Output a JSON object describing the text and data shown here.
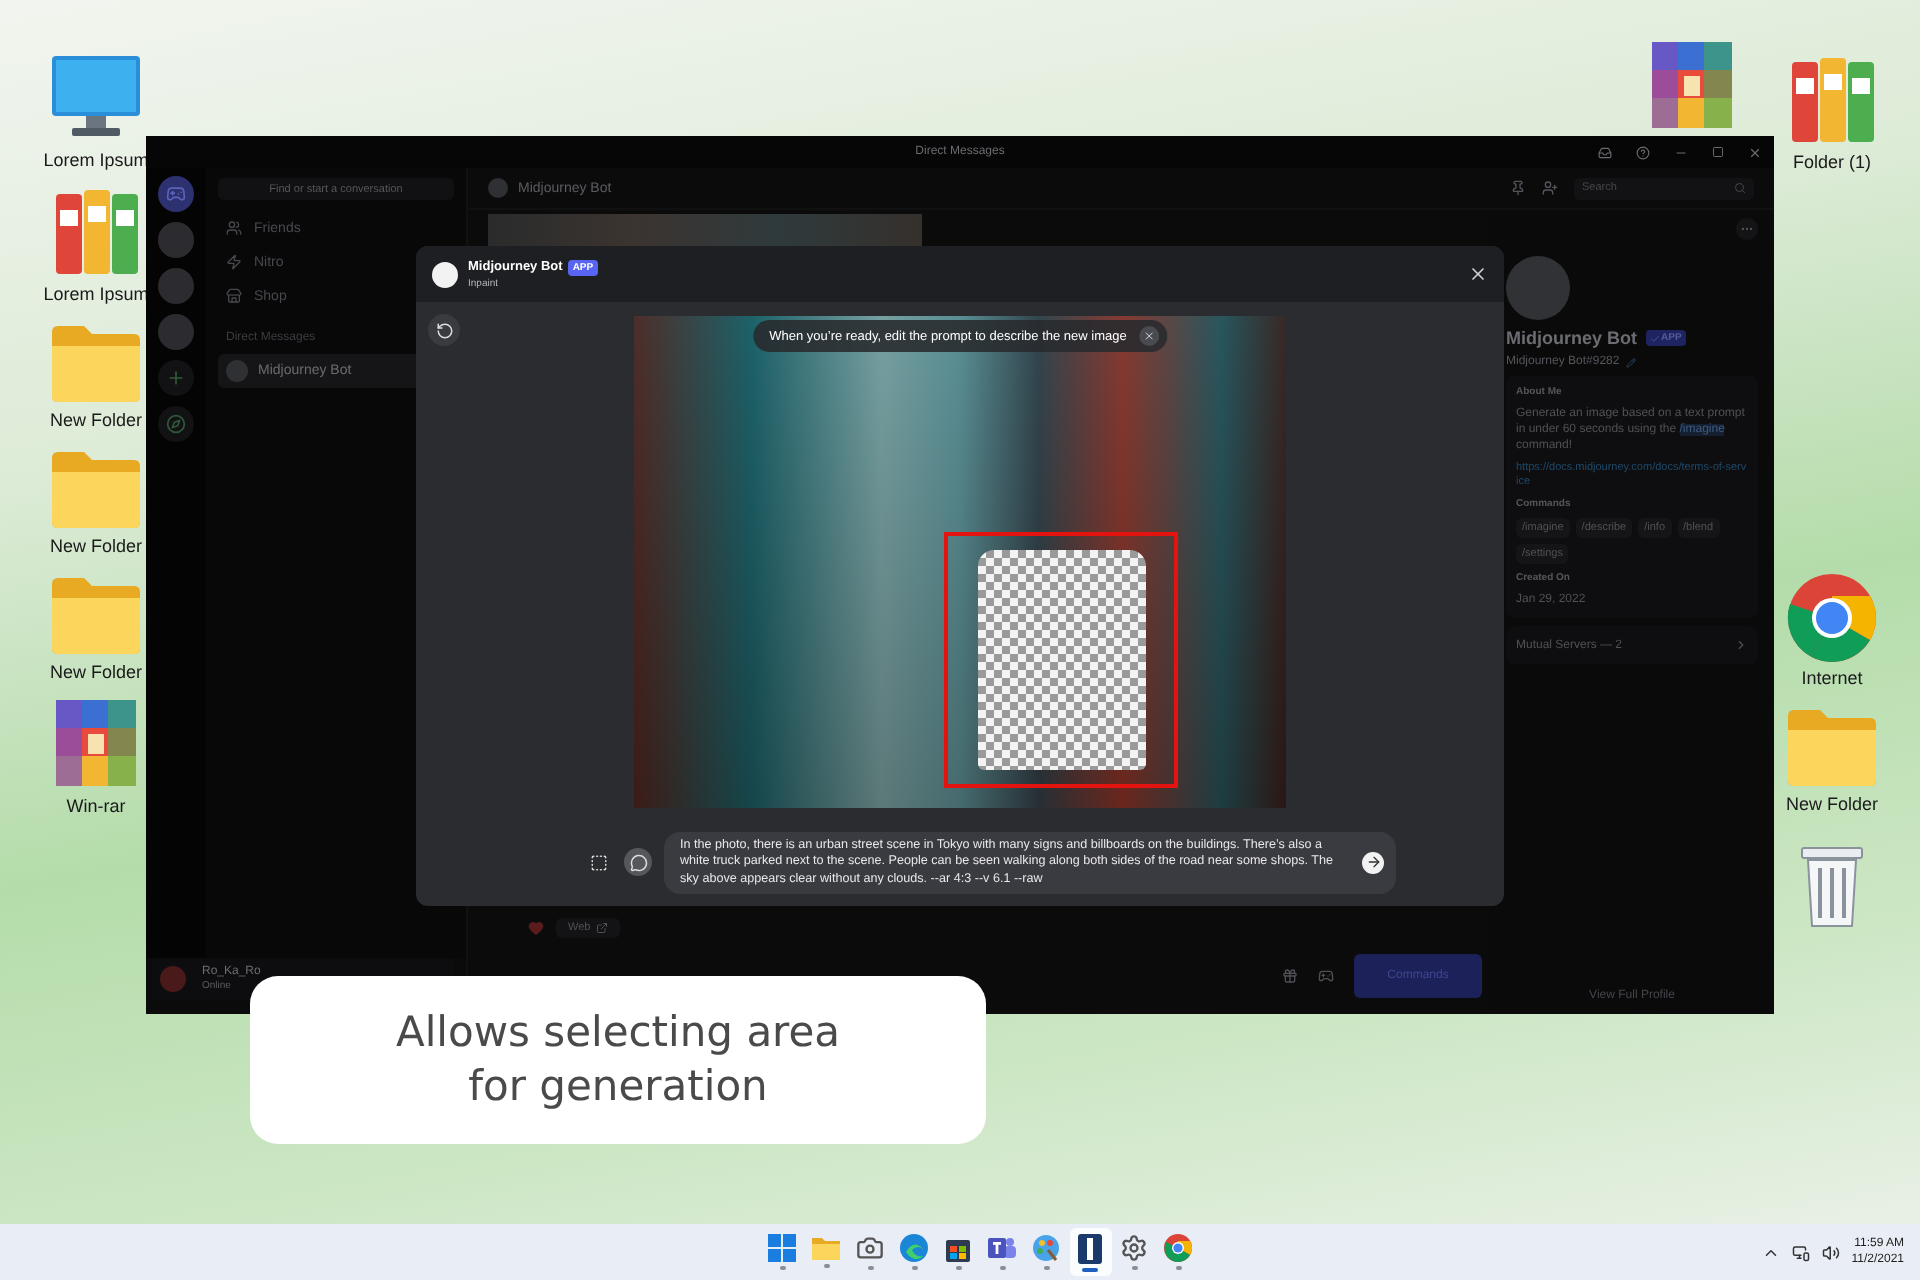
{
  "desktop": {
    "left_icons": [
      {
        "kind": "monitor",
        "label": "Lorem Ipsum"
      },
      {
        "kind": "binders",
        "label": "Lorem Ipsum"
      },
      {
        "kind": "folder",
        "label": "New Folder"
      },
      {
        "kind": "folder",
        "label": "New Folder"
      },
      {
        "kind": "folder",
        "label": "New Folder"
      },
      {
        "kind": "archive",
        "label": "Win-rar"
      }
    ],
    "right_icons": [
      {
        "kind": "archive"
      },
      {
        "kind": "binders",
        "label": "Folder (1)"
      },
      {
        "kind": "browser",
        "label": "Internet"
      },
      {
        "kind": "folder",
        "label": "New Folder"
      },
      {
        "kind": "bin"
      }
    ]
  },
  "window": {
    "title": "Direct Messages"
  },
  "servers": [
    {
      "kind": "home"
    },
    {
      "kind": "server"
    },
    {
      "kind": "server"
    },
    {
      "kind": "server"
    },
    {
      "kind": "add"
    },
    {
      "kind": "explore"
    }
  ],
  "sidebar": {
    "search_placeholder": "Find or start a conversation",
    "items": [
      {
        "kind": "friends",
        "label": "Friends"
      },
      {
        "kind": "nitro",
        "label": "Nitro"
      },
      {
        "kind": "shop",
        "label": "Shop"
      }
    ],
    "section_title": "Direct Messages",
    "direct_messages": [
      {
        "name": "Midjourney Bot",
        "selected": true
      }
    ],
    "user": {
      "name": "Ro_Ka_Ro",
      "status": "Online"
    }
  },
  "chat": {
    "title": "Midjourney Bot",
    "search_placeholder": "Search",
    "reaction_label": "Web",
    "commands_button": "Commands"
  },
  "profile": {
    "name": "Midjourney Bot",
    "badge": "APP",
    "tag": "Midjourney Bot#9282",
    "about_title": "About Me",
    "about": "Generate an image based on a text prompt in under 60 seconds using the ",
    "about_command": "/imagine",
    "about_end": " command!",
    "link": "https://docs.midjourney.com/docs/terms-of-service",
    "commands_title": "Commands",
    "commands": [
      "/imagine",
      "/describe",
      "/info",
      "/blend",
      "/settings"
    ],
    "created_title": "Created On",
    "created": "Jan 29, 2022",
    "mutual": "Mutual Servers — 2",
    "view_profile": "View Full Profile"
  },
  "modal": {
    "bot_name": "Midjourney Bot",
    "badge": "APP",
    "subtitle": "Inpaint",
    "banner": "When you’re ready, edit the prompt to describe the new image",
    "prompt": "In the photo, there is an urban street scene in Tokyo with many signs and billboards on the buildings. There’s also a white truck parked next to the scene. People can be seen walking along both sides of the road near some shops. The sky above appears clear without any clouds. --ar 4:3 --v 6.1 --raw"
  },
  "caption": "Allows selecting area for generation",
  "taskbar": {
    "apps": [
      {
        "kind": "start",
        "active": false
      },
      {
        "kind": "explorer",
        "active": false
      },
      {
        "kind": "camera",
        "active": false
      },
      {
        "kind": "edge",
        "active": false
      },
      {
        "kind": "store",
        "active": false
      },
      {
        "kind": "teams",
        "active": false
      },
      {
        "kind": "paint",
        "active": false
      },
      {
        "kind": "app",
        "active": true
      },
      {
        "kind": "settings",
        "active": false
      },
      {
        "kind": "chrome",
        "active": false
      }
    ],
    "time": "11:59 AM",
    "date": "11/2/2021"
  }
}
